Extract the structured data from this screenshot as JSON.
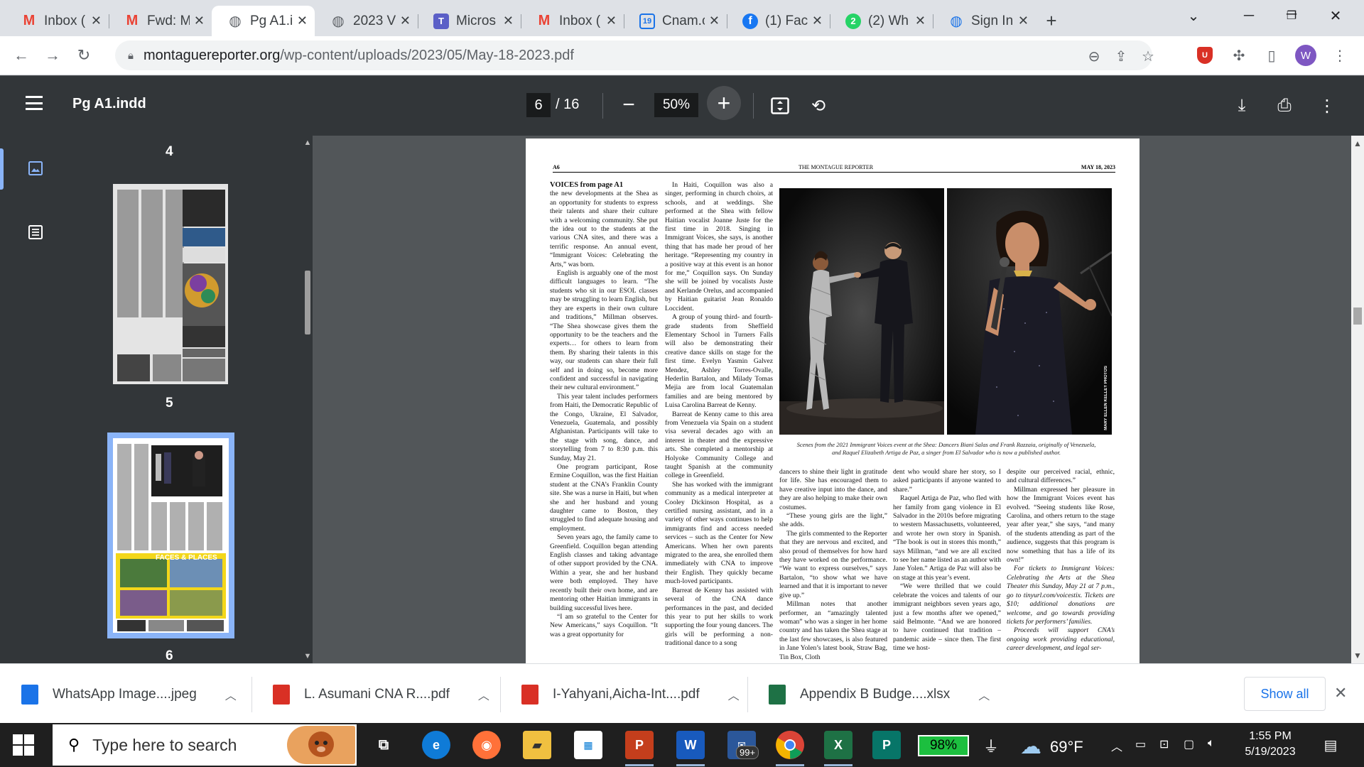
{
  "browser": {
    "tabs": [
      {
        "label": "Inbox (",
        "icon": "gmail-icon",
        "icon_char": "M",
        "icon_color": "#ea4335",
        "active": false
      },
      {
        "label": "Fwd: M",
        "icon": "gmail-icon",
        "icon_char": "M",
        "icon_color": "#ea4335",
        "active": false
      },
      {
        "label": "Pg A1.i",
        "icon": "globe-icon",
        "icon_char": "◍",
        "icon_color": "#5f6368",
        "active": true
      },
      {
        "label": "2023 V",
        "icon": "globe-icon",
        "icon_char": "◍",
        "icon_color": "#5f6368",
        "active": false
      },
      {
        "label": "Micros",
        "icon": "teams-icon",
        "icon_char": "T",
        "icon_color": "#5b5fc7",
        "active": false
      },
      {
        "label": "Inbox (",
        "icon": "gmail-icon",
        "icon_char": "M",
        "icon_color": "#ea4335",
        "active": false
      },
      {
        "label": "Cnam.c",
        "icon": "calendar-icon",
        "icon_char": "19",
        "icon_color": "#1a73e8",
        "active": false
      },
      {
        "label": "(1) Fac",
        "icon": "facebook-icon",
        "icon_char": "f",
        "icon_color": "#1877f2",
        "active": false
      },
      {
        "label": "(2) Wh",
        "icon": "whatsapp-icon",
        "icon_char": "2",
        "icon_color": "#25d366",
        "active": false
      },
      {
        "label": "Sign In",
        "icon": "globe-icon",
        "icon_char": "◍",
        "icon_color": "#1a73e8",
        "active": false
      }
    ],
    "close_glyph": "✕",
    "new_tab_glyph": "+",
    "url_domain": "montaguereporter.org",
    "url_path": "/wp-content/uploads/2023/05/May-18-2023.pdf",
    "profile_initial": "W",
    "profile_color": "#7e57c2",
    "extension_color": "#d93025"
  },
  "pdf": {
    "title": "Pg A1.indd",
    "current_page": "6",
    "total_pages": "/ 16",
    "zoom": "50%",
    "thumb_labels": [
      "4",
      "5",
      "6"
    ]
  },
  "newspaper": {
    "header_left": "A6",
    "header_center": "THE MONTAGUE REPORTER",
    "header_right": "MAY 18, 2023",
    "col1": {
      "kicker": "VOICES from page A1",
      "paras": [
        "the new developments at the Shea as an opportunity for students to express their talents and share their culture with a welcoming community. She put the idea out to the students at the various CNA sites, and there was a terrific response. An annual event, “Immigrant Voices: Celebrating the Arts,” was born.",
        "English is arguably one of the most difficult languages to learn. “The students who sit in our ESOL classes may be struggling to learn English, but they are experts in their own culture and traditions,” Millman observes. “The Shea showcase gives them the opportunity to be the teachers and the experts… for others to learn from them. By sharing their talents in this way, our students can share their full self and in doing so, become more confident and successful in navigating their new cultural environment.”",
        "This year talent includes performers from Haiti, the Democratic Republic of the Congo, Ukraine, El Salvador, Venezuela, Guatemala, and possibly Afghanistan. Participants will take to the stage with song, dance, and storytelling from 7 to 8:30 p.m. this Sunday, May 21.",
        "One program participant, Rose Ermine Coquillon, was the first Haitian student at the CNA’s Franklin County site. She was a nurse in Haiti, but when she and her husband and young daughter came to Boston, they struggled to find adequate housing and employment.",
        "Seven years ago, the family came to Greenfield. Coquillon began attending English classes and taking advantage of other support provided by the CNA. Within a year, she and her husband were both employed. They have recently built their own home, and are mentoring other Haitian immigrants in building successful lives here.",
        "“I am so grateful to the Center for New Americans,” says Coquillon. “It was a great opportunity for"
      ]
    },
    "col2": {
      "paras": [
        "In Haiti, Coquillon was also a singer, performing in church choirs, at schools, and at weddings. She performed at the Shea with fellow Haitian vocalist Joanne Juste for the first time in 2018. Singing in Immigrant Voices, she says, is another thing that has made her proud of her heritage. “Representing my country in a positive way at this event is an honor for me,” Coquillon says. On Sunday she will be joined by vocalists Juste and Kerlande Orelus, and accompanied by Haitian guitarist Jean Ronaldo Loccident.",
        "A group of young third- and fourth-grade students from Sheffield Elementary School in Turners Falls will also be demonstrating their creative dance skills on stage for the first time. Evelyn Yasmin Galvez Mendez, Ashley Torres-Ovalle, Hederlin Bartalon, and Milady Tomas Mejia are from local Guatemalan families and are being mentored by Luisa Carolina Barreat de Kenny.",
        "Barreat de Kenny came to this area from Venezuela via Spain on a student visa several decades ago with an interest in theater and the expressive arts. She completed a mentorship at Holyoke Community College and taught Spanish at the community college in Greenfield.",
        "She has worked with the immigrant community as a medical interpreter at Cooley Dickinson Hospital, as a certified nursing assistant, and in a variety of other ways continues to help immigrants find and access needed services – such as the Center for New Americans. When her own parents migrated to the area, she enrolled them immediately with CNA to improve their English. They quickly became much-loved participants.",
        "Barreat de Kenny has assisted with several of the CNA dance performances in the past, and decided this year to put her skills to work supporting the four young dancers. The girls will be performing a non-traditional dance to a song"
      ]
    },
    "col3": {
      "paras": [
        "dancers to shine their light in gratitude for life. She has encouraged them to have creative input into the dance, and they are also helping to make their own costumes.",
        "“These young girls are the light,” she adds.",
        "The girls commented to the Reporter that they are nervous and excited, and also proud of themselves for how hard they have worked on the performance. “We want to express ourselves,” says Bartalon, “to show what we have learned and that it is important to never give up.”",
        "Millman notes that another performer, an “amazingly talented woman” who was a singer in her home country and has taken the Shea stage at the last few showcases, is also featured in Jane Yolen’s latest book, Straw Bag, Tin Box, Cloth"
      ]
    },
    "col4": {
      "paras": [
        "dent who would share her story, so I asked participants if anyone wanted to share.”",
        "Raquel Artiga de Paz, who fled with her family from gang violence in El Salvador in the 2010s before migrating to western Massachusetts, volunteered, and wrote her own story in Spanish. “The book is out in stores this month,” says Millman, “and we are all excited to see her name listed as an author with Jane Yolen.” Artiga de Paz will also be on stage at this year’s event.",
        "“We were thrilled that we could celebrate the voices and talents of our immigrant neighbors seven years ago, just a few months after we opened,” said Belmonte. “And we are honored to have continued that tradition – pandemic aside – since then. The first time we host-"
      ]
    },
    "col5": {
      "paras": [
        "despite our perceived racial, ethnic, and cultural differences.”",
        "Millman expressed her pleasure in how the Immigrant Voices event has evolved. “Seeing students like Rose, Carolina, and others return to the stage year after year,” she says, “and many of the students attending as part of the audience, suggests that this program is now something that has a life of its own!”",
        "For tickets to Immigrant Voices: Celebrating the Arts at the Shea Theater this Sunday, May 21 at 7 p.m., go to tinyurl.com/voicestix. Tickets are $10; additional donations are welcome, and go towards providing tickets for performers’ families.",
        "Proceeds will support CNA’s ongoing work providing educational, career development, and legal ser-"
      ]
    },
    "caption": "Scenes from the 2021 Immigrant Voices event at the Shea: Dancers Biani Salas and Frank Razzaia, originally of Venezuela, and Raquel Elizabeth Artiga de Paz, a singer from El Salvador who is now a published author.",
    "photo_credit": "MARY ELLEN KELLEY PHOTOS"
  },
  "downloads": [
    {
      "name": "WhatsApp Image....jpeg",
      "icon": "image-file-icon",
      "color": "#1a73e8"
    },
    {
      "name": "L. Asumani CNA R....pdf",
      "icon": "pdf-file-icon",
      "color": "#d93025"
    },
    {
      "name": "I-Yahyani,Aicha-Int....pdf",
      "icon": "pdf-file-icon",
      "color": "#d93025"
    },
    {
      "name": "Appendix B Budge....xlsx",
      "icon": "excel-file-icon",
      "color": "#1e7145"
    }
  ],
  "show_all": "Show all",
  "taskbar": {
    "search_placeholder": "Type here to search",
    "badge": "99+",
    "battery": "98%",
    "temperature": "69°F",
    "time": "1:55 PM",
    "date": "5/19/2023"
  }
}
